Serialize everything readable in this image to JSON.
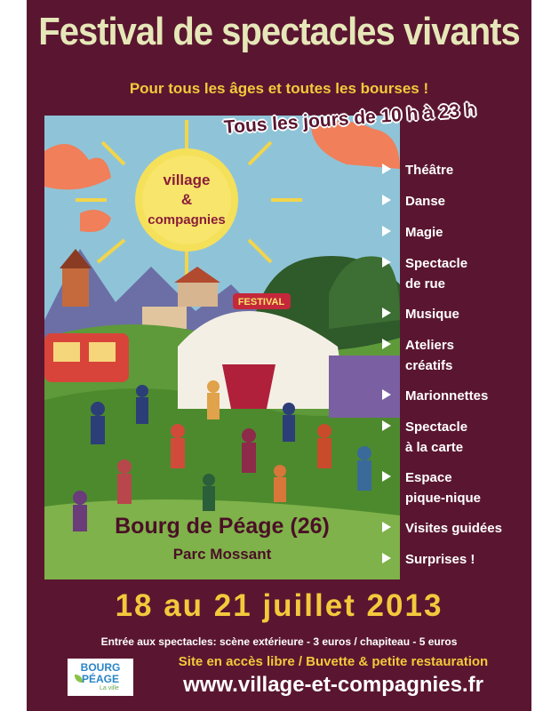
{
  "poster": {
    "title": "Festival de spectacles vivants",
    "subtitle": "Pour tous les âges et toutes les bourses !",
    "hours": "Tous les jours de 10 h à 23 h",
    "artwork": {
      "sun_text_top": "village",
      "sun_text_mid": "&",
      "sun_text_bottom": "compagnies",
      "tent_sign": "FESTIVAL"
    },
    "activities": [
      {
        "label": "Théâtre"
      },
      {
        "label": "Danse"
      },
      {
        "label": "Magie"
      },
      {
        "label": "Spectacle\nde rue"
      },
      {
        "label": "Musique"
      },
      {
        "label": "Ateliers\ncréatifs"
      },
      {
        "label": "Marionnettes"
      },
      {
        "label": "Spectacle\nà la carte"
      },
      {
        "label": "Espace\npique-nique"
      },
      {
        "label": "Visites guidées"
      },
      {
        "label": "Surprises !"
      }
    ],
    "town": "Bourg de Péage (26)",
    "park": "Parc Mossant",
    "dates": "18 au 21 juillet 2013",
    "entry": "Entrée aux spectacles: scène extérieure - 3 euros / chapiteau - 5 euros",
    "access": "Site en accès libre / Buvette & petite restauration",
    "url": "www.village-et-compagnies.fr",
    "logo": {
      "line1": "BOURG",
      "line2": "PÉAGE",
      "line3": "La ville"
    }
  },
  "colors": {
    "background": "#5a1630",
    "title": "#e6e7b8",
    "accent_yellow": "#f3c93c",
    "text": "#ffffff"
  }
}
